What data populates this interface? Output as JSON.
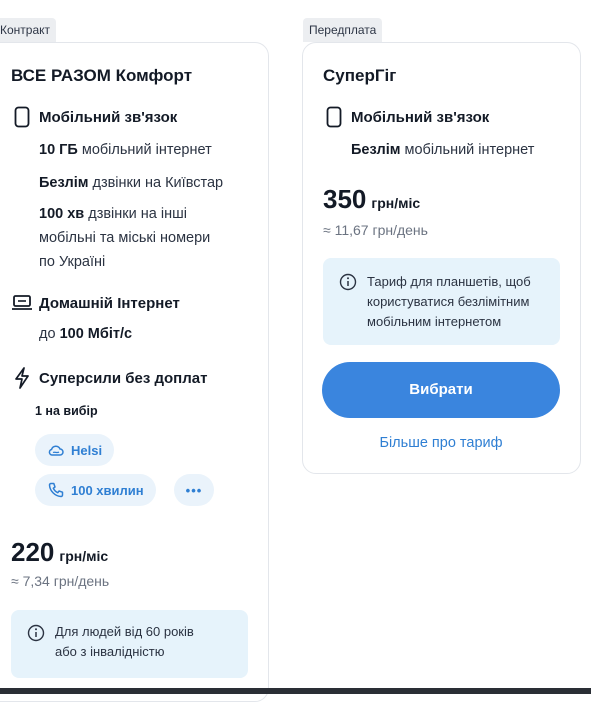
{
  "contract": {
    "tag": "Контракт",
    "title": "ВСЕ РАЗОМ Комфорт",
    "mobile": {
      "title": "Мобільний зв'язок",
      "gb_bold": "10 ГБ",
      "gb_text": "мобільний інтернет",
      "unlim_bold": "Безлім",
      "unlim_text": "дзвінки на Київстар",
      "min_bold": "100 хв",
      "min_text_1": "дзвінки на інші",
      "min_text_2": "мобільні та міські номери",
      "min_text_3": "по Україні"
    },
    "home": {
      "title": "Домашній Інтернет",
      "speed_prefix": "до",
      "speed_bold": "100 Мбіт/с"
    },
    "super": {
      "title": "Суперсили без доплат",
      "choice": "1 на вибір",
      "pill_helsi": "Helsi",
      "pill_minutes": "100 хвилин",
      "pill_more": "•••"
    },
    "price": "220",
    "price_unit": "грн/міс",
    "per_day": "≈ 7,34 грн/день",
    "note_line1": "Для людей від 60 років",
    "note_line2": "або з інвалідністю"
  },
  "prepaid": {
    "tag": "Передплата",
    "title": "СуперГіг",
    "mobile": {
      "title": "Мобільний зв'язок",
      "unlim_bold": "Безлім",
      "unlim_text": "мобільний інтернет"
    },
    "price": "350",
    "price_unit": "грн/міс",
    "per_day": "≈ 11,67 грн/день",
    "note_line1": "Тариф для планшетів, щоб",
    "note_line2": "користуватися безлімітним",
    "note_line3": "мобільним інтернетом",
    "select_button": "Вибрати",
    "more_link": "Більше про тариф"
  },
  "colors": {
    "accent": "#3a85de",
    "note_bg": "#e6f3fb",
    "tag_bg": "#eceef1"
  }
}
